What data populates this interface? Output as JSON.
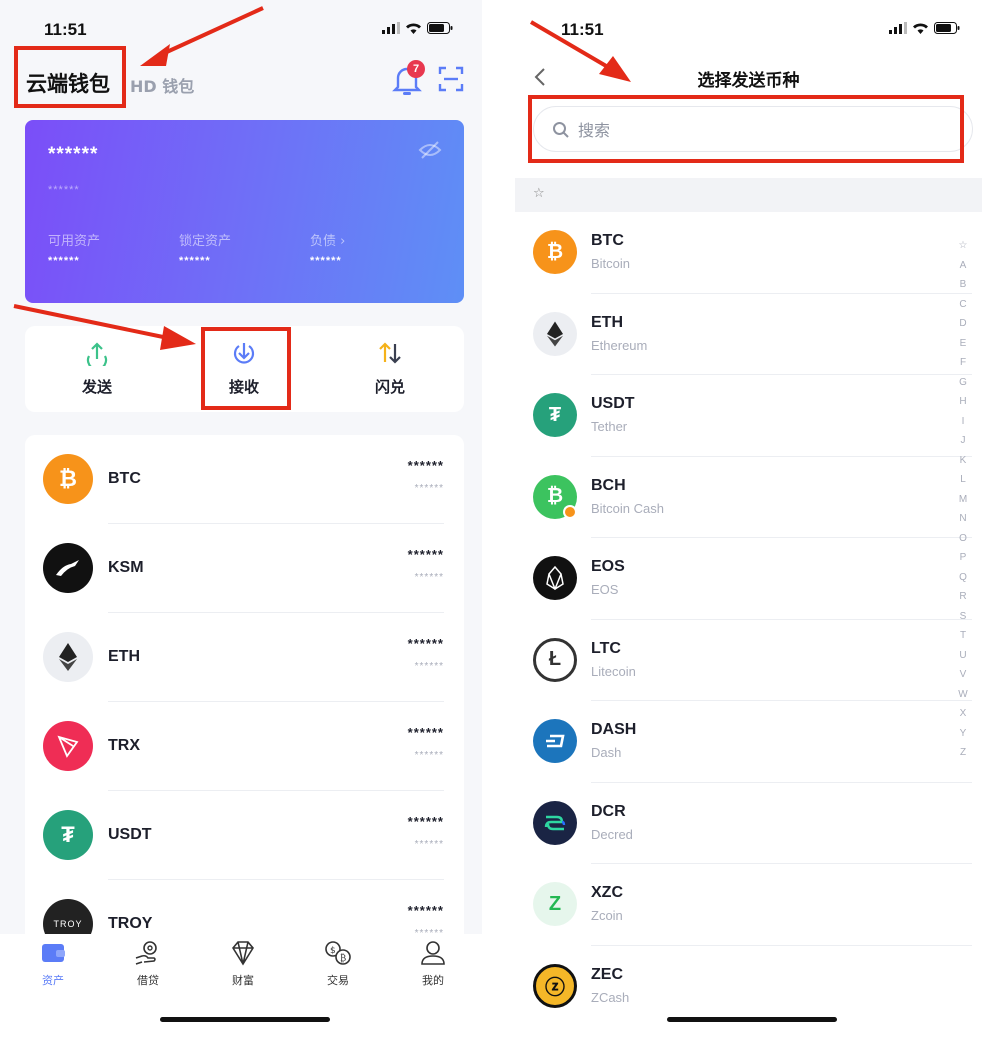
{
  "colors": {
    "accent": "#5b7cf7",
    "annotation_red": "#e32a18",
    "badge": "#e8384f"
  },
  "status": {
    "time_left": "11:51",
    "time_right": "11:51"
  },
  "left": {
    "wallet_title": "云端钱包",
    "hd_tab": "HD 钱包",
    "notification_count": "7",
    "card": {
      "total_hidden": "******",
      "sub_hidden": "******",
      "cols": [
        {
          "label": "可用资产",
          "value": "******"
        },
        {
          "label": "锁定资产",
          "value": "******"
        },
        {
          "label": "负债 ›",
          "value": "******"
        }
      ]
    },
    "actions": [
      {
        "label": "发送",
        "icon": "send-up-arrow-icon"
      },
      {
        "label": "接收",
        "icon": "receive-down-arrow-icon"
      },
      {
        "label": "闪兑",
        "icon": "swap-arrows-icon"
      }
    ],
    "assets": [
      {
        "symbol": "BTC",
        "v1": "******",
        "v2": "******",
        "color": "#f7931a",
        "glyph": "₿"
      },
      {
        "symbol": "KSM",
        "v1": "******",
        "v2": "******",
        "color": "#111111",
        "glyph": ""
      },
      {
        "symbol": "ETH",
        "v1": "******",
        "v2": "******",
        "color": "#eceef2",
        "glyph": ""
      },
      {
        "symbol": "TRX",
        "v1": "******",
        "v2": "******",
        "color": "#ef2d55",
        "glyph": ""
      },
      {
        "symbol": "USDT",
        "v1": "******",
        "v2": "******",
        "color": "#26a17b",
        "glyph": "₮"
      },
      {
        "symbol": "TROY",
        "v1": "******",
        "v2": "******",
        "color": "#222222",
        "glyph": "TROY"
      }
    ],
    "tabs": [
      {
        "label": "资产",
        "icon": "wallet-icon"
      },
      {
        "label": "借贷",
        "icon": "loan-hand-icon"
      },
      {
        "label": "财富",
        "icon": "diamond-icon"
      },
      {
        "label": "交易",
        "icon": "exchange-coins-icon"
      },
      {
        "label": "我的",
        "icon": "profile-icon"
      }
    ]
  },
  "right": {
    "title": "选择发送币种",
    "search_placeholder": "搜索",
    "fav_star": "☆",
    "coins": [
      {
        "symbol": "BTC",
        "name": "Bitcoin",
        "color": "#f7931a",
        "glyph": "₿"
      },
      {
        "symbol": "ETH",
        "name": "Ethereum",
        "color": "#eceef2",
        "glyph": ""
      },
      {
        "symbol": "USDT",
        "name": "Tether",
        "color": "#26a17b",
        "glyph": "₮"
      },
      {
        "symbol": "BCH",
        "name": "Bitcoin Cash",
        "color": "#3cc35f",
        "glyph": "₿"
      },
      {
        "symbol": "EOS",
        "name": "EOS",
        "color": "#111111",
        "glyph": ""
      },
      {
        "symbol": "LTC",
        "name": "Litecoin",
        "color": "#ffffff",
        "glyph": "Ł"
      },
      {
        "symbol": "DASH",
        "name": "Dash",
        "color": "#1c75bc",
        "glyph": ""
      },
      {
        "symbol": "DCR",
        "name": "Decred",
        "color": "#1a2444",
        "glyph": ""
      },
      {
        "symbol": "XZC",
        "name": "Zcoin",
        "color": "#e6f6ec",
        "glyph": "Z"
      },
      {
        "symbol": "ZEC",
        "name": "ZCash",
        "color": "#f4b728",
        "glyph": "ⓩ"
      }
    ],
    "index": [
      "☆",
      "A",
      "B",
      "C",
      "D",
      "E",
      "F",
      "G",
      "H",
      "I",
      "J",
      "K",
      "L",
      "M",
      "N",
      "O",
      "P",
      "Q",
      "R",
      "S",
      "T",
      "U",
      "V",
      "W",
      "X",
      "Y",
      "Z"
    ]
  }
}
